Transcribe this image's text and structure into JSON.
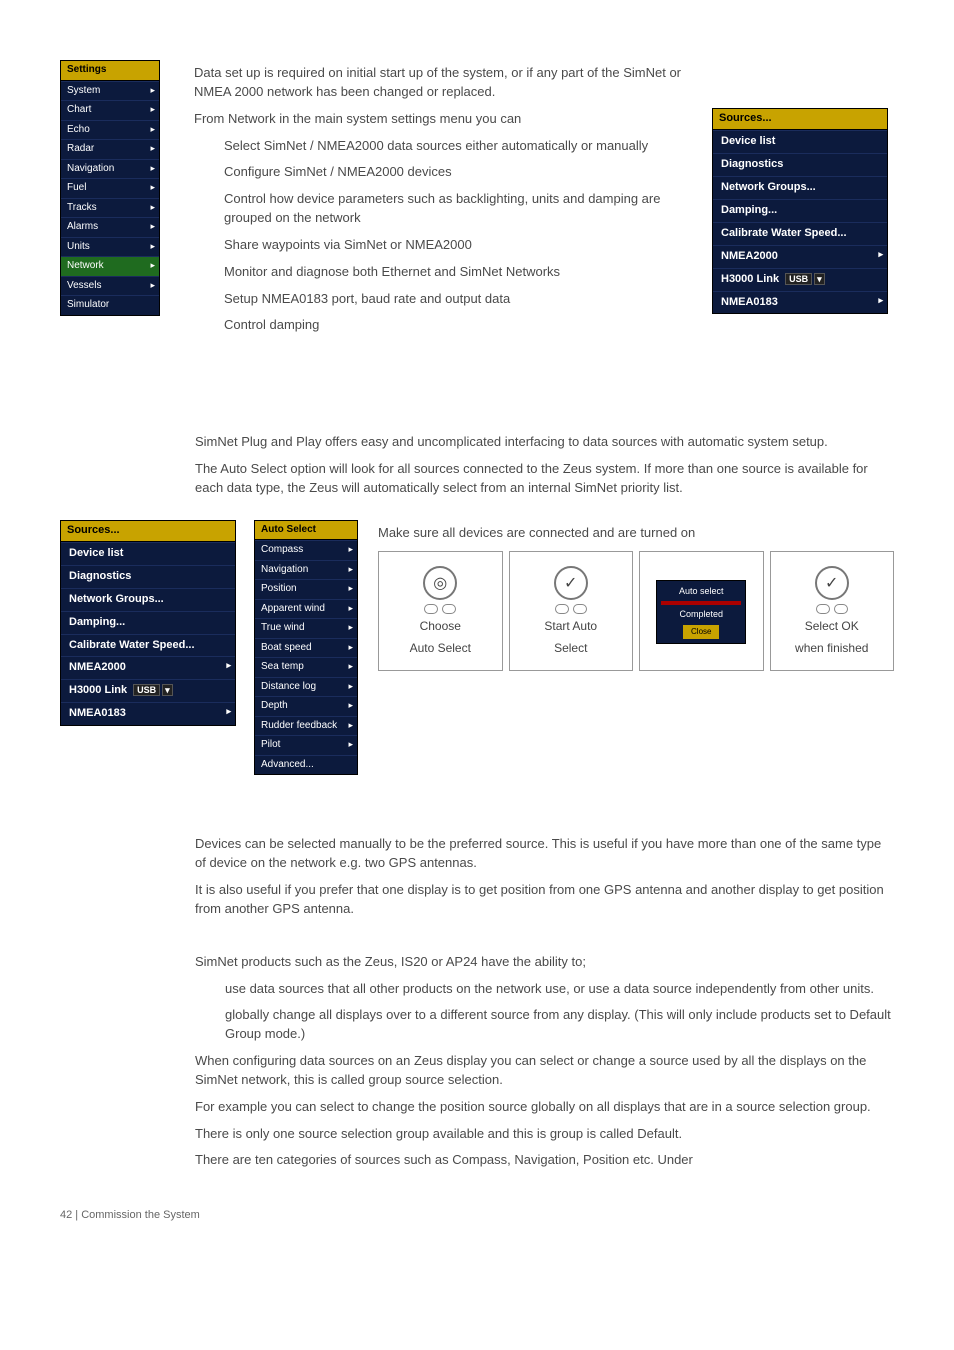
{
  "settings_menu": {
    "title": "Settings",
    "items": [
      "System",
      "Chart",
      "Echo",
      "Radar",
      "Navigation",
      "Fuel",
      "Tracks",
      "Alarms",
      "Units",
      "Network",
      "Vessels",
      "Simulator"
    ],
    "selected_index": 9
  },
  "network_menu_right": {
    "title": "Sources...",
    "items": [
      {
        "label": "Device list"
      },
      {
        "label": "Diagnostics"
      },
      {
        "label": "Network Groups..."
      },
      {
        "label": "Damping..."
      },
      {
        "label": "Calibrate Water Speed..."
      },
      {
        "label": "NMEA2000",
        "arrow": true
      },
      {
        "label": "H3000 Link",
        "pill": "USB",
        "dd": true
      },
      {
        "label": "NMEA0183",
        "arrow": true
      }
    ]
  },
  "section1": {
    "p1": "Data set up is required on initial start up of the system, or if any part of the SimNet or NMEA 2000 network has been changed or replaced.",
    "p2": "From Network in the main system settings menu you can",
    "bullets": [
      "Select SimNet / NMEA2000 data sources either automatically or manually",
      "Configure SimNet / NMEA2000 devices",
      "Control how device parameters such as backlighting, units and damping are grouped on the network",
      "Share waypoints via SimNet or NMEA2000",
      "Monitor and diagnose both Ethernet and SimNet Networks",
      "Setup NMEA0183 port, baud rate and output data",
      "Control damping"
    ]
  },
  "section2": {
    "p1": "SimNet Plug and Play offers easy and uncomplicated interfacing to data sources with automatic system setup.",
    "p2": "The Auto Select option will look for all sources connected to the Zeus system. If more than one source is available for each data type, the Zeus will automatically select from an internal SimNet priority list."
  },
  "network_menu_left": {
    "title": "Sources...",
    "items": [
      {
        "label": "Device list"
      },
      {
        "label": "Diagnostics"
      },
      {
        "label": "Network Groups..."
      },
      {
        "label": "Damping..."
      },
      {
        "label": "Calibrate Water Speed..."
      },
      {
        "label": "NMEA2000",
        "arrow": true
      },
      {
        "label": "H3000 Link",
        "pill": "USB",
        "dd": true
      },
      {
        "label": "NMEA0183",
        "arrow": true
      }
    ]
  },
  "auto_select_menu": {
    "title": "Auto Select",
    "items": [
      "Compass",
      "Navigation",
      "Position",
      "Apparent wind",
      "True wind",
      "Boat speed",
      "Sea temp",
      "Distance log",
      "Depth",
      "Rudder feedback",
      "Pilot",
      "Advanced..."
    ]
  },
  "wizard": {
    "intro": "Make sure all devices are connected and are turned on",
    "step1_l1": "Choose",
    "step1_l2": "Auto Select",
    "step2_l1": "Start Auto",
    "step2_l2": "Select",
    "step3_top": "Auto select",
    "step3_mid": "Completed",
    "step3_btn": "Close",
    "step4_l1": "Select OK",
    "step4_l2": "when finished"
  },
  "section4": {
    "p1": "Devices can be selected manually to be the preferred source. This is useful if you have more than one of the same type of device on the network e.g. two GPS antennas.",
    "p2": "It is also useful if you prefer that one display is to get position from one GPS antenna and another display to get position from another GPS antenna."
  },
  "section5": {
    "p1": "SimNet products such as the Zeus, IS20 or AP24 have the ability to;",
    "bullets": [
      "use data sources that all other products on the network use, or use a data source independently from other units.",
      "globally change all displays over to a different source from any display. (This will only include products set to Default Group mode.)"
    ],
    "p2": "When configuring data sources on an Zeus display you can select or change a source used by all the displays on the SimNet network, this is called group source selection.",
    "p3": "For example you can select to change the position source globally on all displays that are in a source selection group.",
    "p4": "There is only one source selection group available and this is group is called Default.",
    "p5": "There are ten categories of sources such as Compass, Navigation, Position etc. Under"
  },
  "footer": "42 | Commission the System"
}
